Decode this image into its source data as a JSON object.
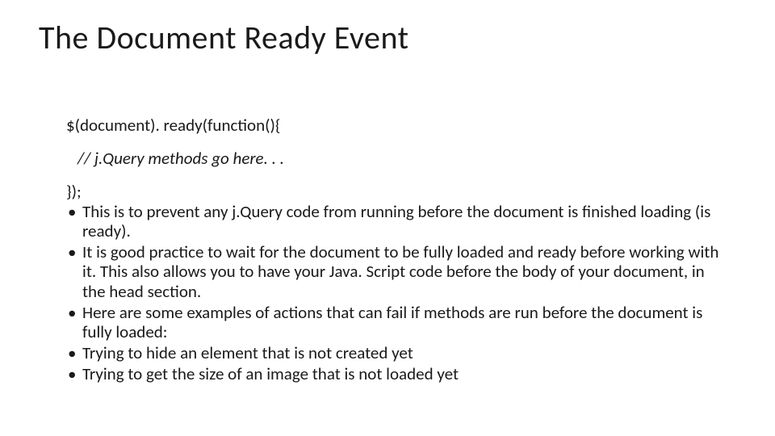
{
  "title": "The Document Ready Event",
  "code": {
    "line1": "$(document). ready(function(){",
    "line2": "// j.Query methods go here. . .",
    "line3": "});"
  },
  "bullets": [
    "This is to prevent any j.Query code from running before the document is finished loading (is ready).",
    "It is good practice to wait for the document to be fully loaded and ready before working with it. This also allows you to have your Java. Script code before the body of your document, in the head section.",
    "Here are some examples of actions that can fail if methods are run before the document is fully loaded:",
    "Trying to hide an element that is not created yet",
    "Trying to get the size of an image that is not loaded yet"
  ]
}
